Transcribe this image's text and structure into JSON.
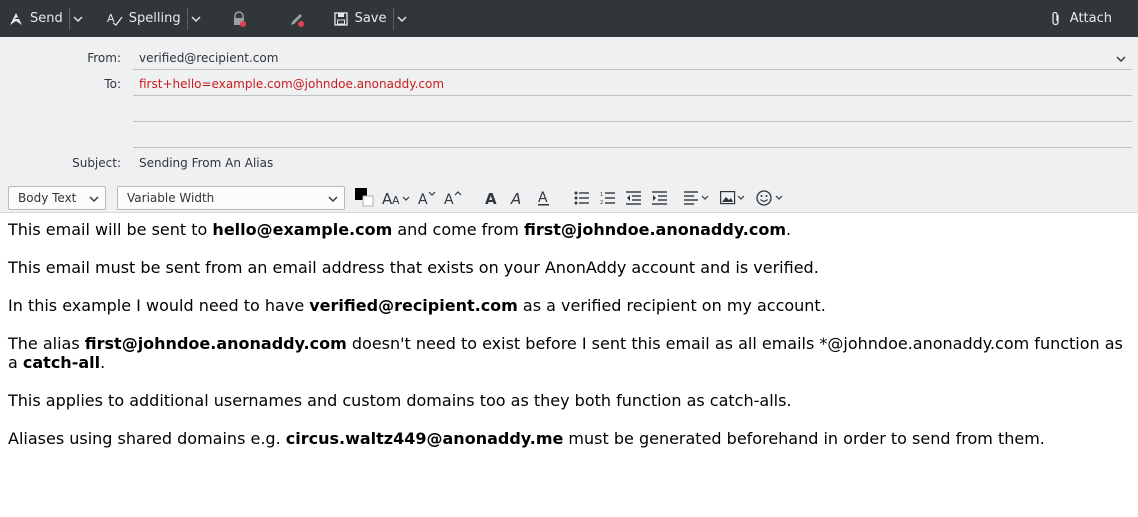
{
  "toolbar": {
    "send_label": "Send",
    "spelling_label": "Spelling",
    "save_label": "Save",
    "attach_label": "Attach"
  },
  "headers": {
    "from_label": "From:",
    "from_value": "verified@recipient.com",
    "to_label": "To:",
    "to_value": "first+hello=example.com@johndoe.anonaddy.com",
    "subject_label": "Subject:",
    "subject_value": "Sending From An Alias"
  },
  "format": {
    "paragraph_style": "Body Text",
    "font": "Variable Width",
    "text_color": "#000000"
  },
  "body": {
    "p1": {
      "t1": "This email will be sent to ",
      "b1": "hello@example.com",
      "t2": " and come from ",
      "b2": "first@johndoe.anonaddy.com",
      "t3": "."
    },
    "p2": "This email must be sent from an email address that exists on your AnonAddy account and is verified.",
    "p3": {
      "t1": "In this example I would need to have ",
      "b1": "verified@recipient.com",
      "t2": " as a verified recipient on my account."
    },
    "p4": {
      "t1": "The alias ",
      "b1": "first@johndoe.anonaddy.com",
      "t2": " doesn't need to exist before I sent this email as all emails *@johndoe.anonaddy.com function as a ",
      "b2": "catch-all",
      "t3": "."
    },
    "p5": "This applies to additional usernames and custom domains too as they both function as catch-alls.",
    "p6": {
      "t1": "Aliases using shared domains e.g. ",
      "b1": "circus.waltz449@anonaddy.me",
      "t2": " must be generated beforehand in order to send from them."
    }
  },
  "colors": {
    "toolbar_bg": "#31363b",
    "header_bg": "#eff0f1",
    "to_text": "#cc1d1d",
    "security_icon": "#da4453"
  }
}
